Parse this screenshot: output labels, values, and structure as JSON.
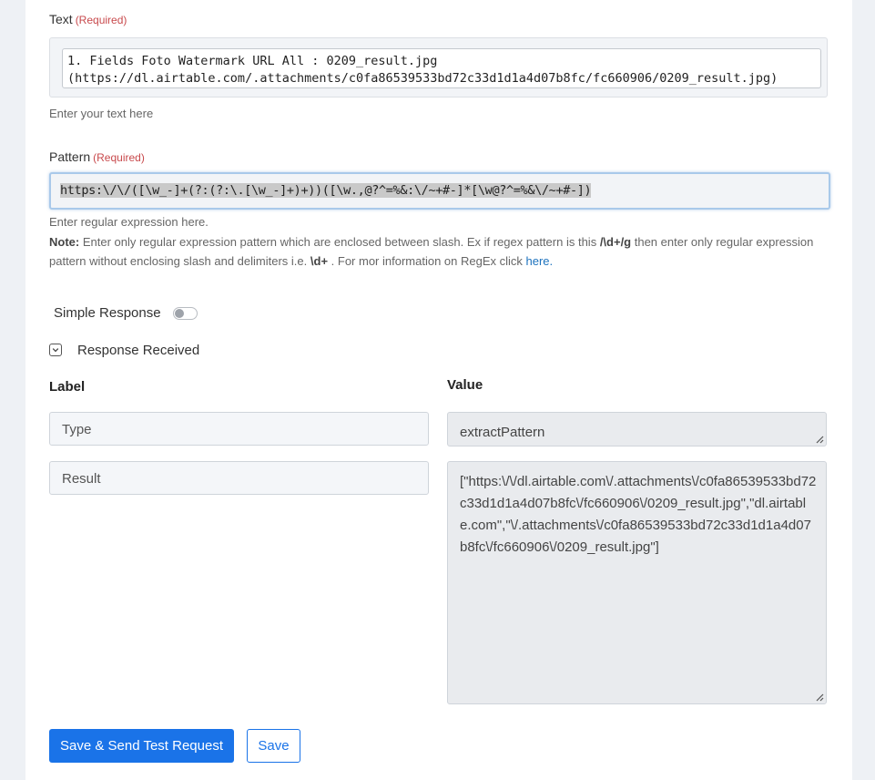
{
  "text_field": {
    "label": "Text",
    "required": "(Required)",
    "value_line1": "1. Fields Foto Watermark URL All : 0209_result.jpg",
    "value_line2": "(https://dl.airtable.com/.attachments/c0fa86539533bd72c33d1d1a4d07b8fc/fc660906/0209_result.jpg)",
    "help": "Enter your text here"
  },
  "pattern_field": {
    "label": "Pattern",
    "required": "(Required)",
    "value": "https:\\/\\/([\\w_-]+(?:(?:\\.[\\w_-]+)+))([\\w.,@?^=%&:\\/~+#-]*[\\w@?^=%&\\/~+#-])",
    "help": "Enter regular expression here.",
    "note_label": "Note:",
    "note_text1": " Enter only regular expression pattern which are enclosed between slash. Ex if regex pattern is this ",
    "note_example": "/\\d+/g",
    "note_text2": " then enter only regular expression pattern without enclosing slash and delimiters i.e. ",
    "note_example2": "\\d+",
    "note_text3": " . For mor information on RegEx click ",
    "note_link": "here."
  },
  "simple_response": {
    "label": "Simple Response",
    "enabled": false
  },
  "response_received": {
    "label": "Response Received"
  },
  "table": {
    "label_header": "Label",
    "value_header": "Value",
    "rows": [
      {
        "label": "Type",
        "value": "extractPattern"
      },
      {
        "label": "Result",
        "value": "[\"https:\\/\\/dl.airtable.com\\/.attachments\\/c0fa86539533bd72c33d1d1a4d07b8fc\\/fc660906\\/0209_result.jpg\",\"dl.airtable.com\",\"\\/.attachments\\/c0fa86539533bd72c33d1d1a4d07b8fc\\/fc660906\\/0209_result.jpg\"]"
      }
    ]
  },
  "buttons": {
    "save_send": "Save & Send Test Request",
    "save": "Save"
  },
  "colors": {
    "primary": "#1a73e8",
    "required": "#c8494c",
    "focus_border": "#a9c9ea"
  }
}
